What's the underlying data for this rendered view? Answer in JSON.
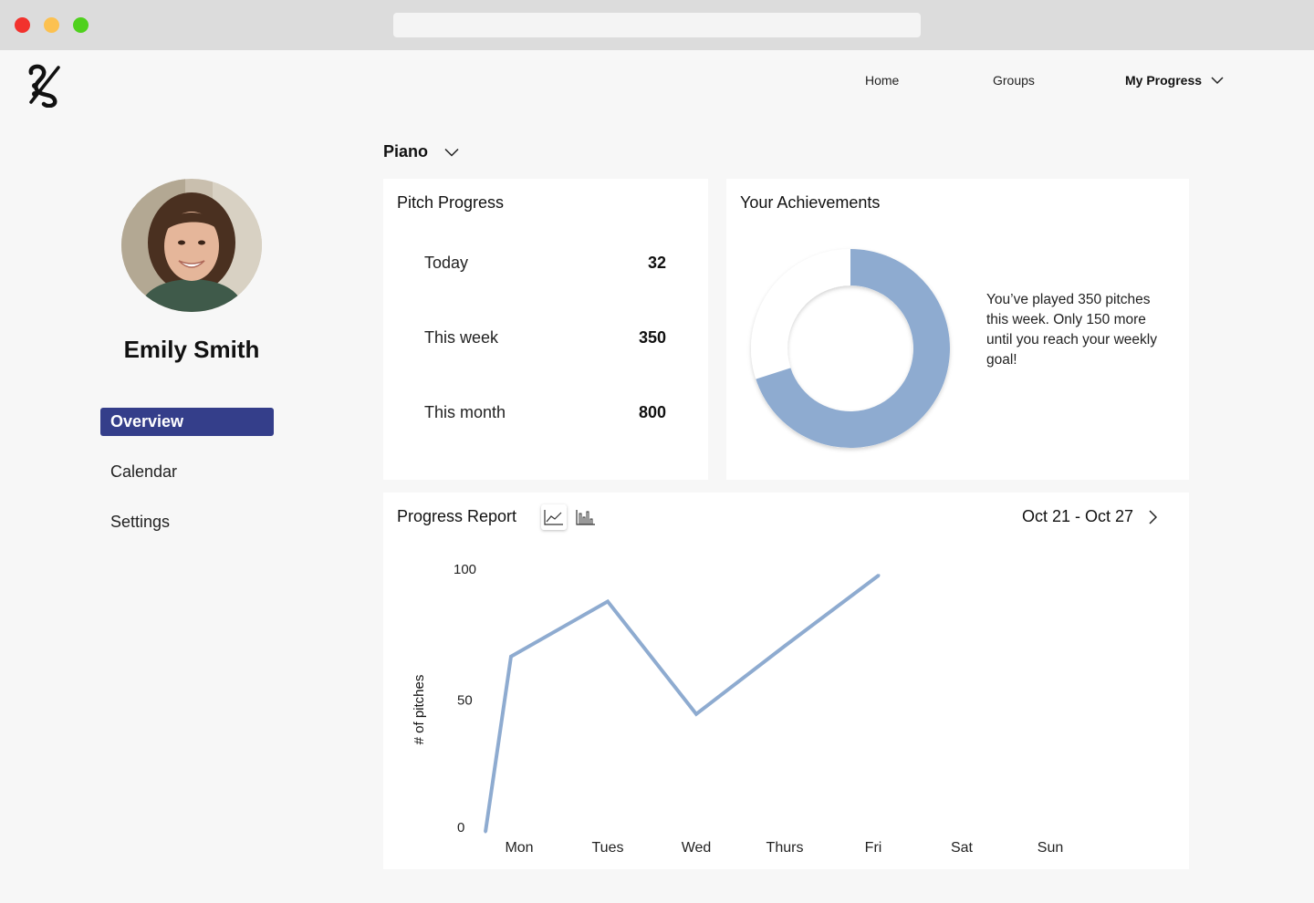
{
  "nav": {
    "home": "Home",
    "groups": "Groups",
    "my_progress": "My Progress"
  },
  "user": {
    "name": "Emily Smith"
  },
  "sidebar": {
    "items": [
      {
        "label": "Overview",
        "active": true
      },
      {
        "label": "Calendar",
        "active": false
      },
      {
        "label": "Settings",
        "active": false
      }
    ]
  },
  "instrument": {
    "selected": "Piano"
  },
  "pitch_progress": {
    "title": "Pitch Progress",
    "rows": [
      {
        "label": "Today",
        "value": "32"
      },
      {
        "label": "This week",
        "value": "350"
      },
      {
        "label": "This month",
        "value": "800"
      }
    ]
  },
  "achievements": {
    "title": "Your Achievements",
    "message": "You’ve played 350 pitches this week. Only 150 more until you reach your weekly goal!",
    "progress": 350,
    "goal": 500
  },
  "report": {
    "title": "Progress Report",
    "date_range": "Oct 21 - Oct 27"
  },
  "colors": {
    "accent": "#343e8a",
    "chart": "#8eabd0"
  },
  "chart_data": {
    "type": "line",
    "categories": [
      "Mon",
      "Tues",
      "Wed",
      "Thurs",
      "Fri",
      "Sat",
      "Sun"
    ],
    "points": [
      {
        "x": "Mon",
        "y": 0
      },
      {
        "x": "Mon",
        "y": 67
      },
      {
        "x": "Tues",
        "y": 88
      },
      {
        "x": "Wed",
        "y": 45
      },
      {
        "x": "Thurs",
        "y": 71
      },
      {
        "x": "Fri",
        "y": 98
      }
    ],
    "ylabel": "# of pitches",
    "yticks": [
      0,
      50,
      100
    ],
    "ylim": [
      0,
      100
    ]
  }
}
